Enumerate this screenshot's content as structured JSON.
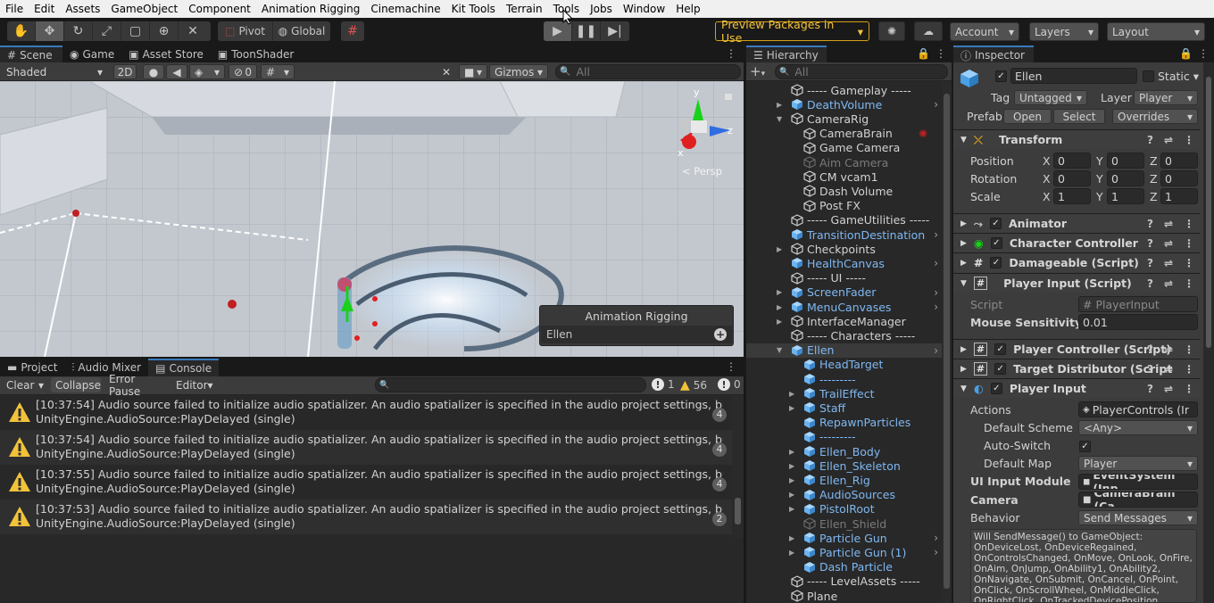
{
  "menu": [
    "File",
    "Edit",
    "Assets",
    "GameObject",
    "Component",
    "Animation Rigging",
    "Cinemachine",
    "Kit Tools",
    "Terrain",
    "Tools",
    "Jobs",
    "Window",
    "Help"
  ],
  "toolbar": {
    "pivot": "Pivot",
    "global": "Global",
    "preview_packages": "Preview Packages in Use",
    "account": "Account",
    "layers": "Layers",
    "layout": "Layout"
  },
  "scene": {
    "tabs": [
      "Scene",
      "Game",
      "Asset Store",
      "ToonShader"
    ],
    "shading": "Shaded",
    "mode_2d": "2D",
    "hidden_count": "0",
    "gizmos": "Gizmos",
    "search_placeholder": "All",
    "persp": "< Persp",
    "gizmo_y": "y",
    "gizmo_z": "z",
    "gizmo_x": "x",
    "overlay_title": "Animation Rigging",
    "overlay_item": "Ellen"
  },
  "console": {
    "tabs": [
      "Project",
      "Audio Mixer",
      "Console"
    ],
    "clear": "Clear",
    "collapse": "Collapse",
    "error_pause": "Error Pause",
    "editor": "Editor",
    "count_errors": "1",
    "count_warnings": "56",
    "count_info": "0",
    "entries": [
      {
        "line1": "[10:37:54] Audio source failed to initialize audio spatializer. An audio spatializer is specified in the audio project settings, but the associated",
        "line2": "UnityEngine.AudioSource:PlayDelayed (single)",
        "count": "4"
      },
      {
        "line1": "[10:37:54] Audio source failed to initialize audio spatializer. An audio spatializer is specified in the audio project settings, but the associated",
        "line2": "UnityEngine.AudioSource:PlayDelayed (single)",
        "count": "4"
      },
      {
        "line1": "[10:37:55] Audio source failed to initialize audio spatializer. An audio spatializer is specified in the audio project settings, but the associated",
        "line2": "UnityEngine.AudioSource:PlayDelayed (single)",
        "count": "4"
      },
      {
        "line1": "[10:37:53] Audio source failed to initialize audio spatializer. An audio spatializer is specified in the audio project settings, but the associated",
        "line2": "UnityEngine.AudioSource:PlayDelayed (single)",
        "count": "2"
      }
    ]
  },
  "hierarchy": {
    "tab": "Hierarchy",
    "add": "+",
    "search_placeholder": "All",
    "items": [
      {
        "label": "----- Gameplay -----",
        "depth": 0,
        "color": "white",
        "fold": ""
      },
      {
        "label": "DeathVolume",
        "depth": 0,
        "color": "blue",
        "fold": "right",
        "arrow": true
      },
      {
        "label": "CameraRig",
        "depth": 0,
        "color": "white",
        "fold": "down"
      },
      {
        "label": "CameraBrain",
        "depth": 1,
        "color": "white",
        "fold": ""
      },
      {
        "label": "Game Camera",
        "depth": 1,
        "color": "white",
        "fold": ""
      },
      {
        "label": "Aim Camera",
        "depth": 1,
        "color": "gray",
        "fold": ""
      },
      {
        "label": "CM vcam1",
        "depth": 1,
        "color": "white",
        "fold": ""
      },
      {
        "label": "Dash Volume",
        "depth": 1,
        "color": "white",
        "fold": ""
      },
      {
        "label": "Post FX",
        "depth": 1,
        "color": "white",
        "fold": ""
      },
      {
        "label": "----- GameUtilities -----",
        "depth": 0,
        "color": "white",
        "fold": ""
      },
      {
        "label": "TransitionDestination",
        "depth": 0,
        "color": "blue",
        "fold": "",
        "arrow": true
      },
      {
        "label": "Checkpoints",
        "depth": 0,
        "color": "white",
        "fold": "right"
      },
      {
        "label": "HealthCanvas",
        "depth": 0,
        "color": "blue",
        "fold": "",
        "arrow": true
      },
      {
        "label": "----- UI -----",
        "depth": 0,
        "color": "white",
        "fold": ""
      },
      {
        "label": "ScreenFader",
        "depth": 0,
        "color": "blue",
        "fold": "right",
        "arrow": true
      },
      {
        "label": "MenuCanvases",
        "depth": 0,
        "color": "blue",
        "fold": "right",
        "arrow": true
      },
      {
        "label": "InterfaceManager",
        "depth": 0,
        "color": "white",
        "fold": "right"
      },
      {
        "label": "----- Characters -----",
        "depth": 0,
        "color": "white",
        "fold": ""
      },
      {
        "label": "Ellen",
        "depth": 0,
        "color": "blue",
        "fold": "down",
        "arrow": true,
        "selected": true
      },
      {
        "label": "HeadTarget",
        "depth": 1,
        "color": "blue",
        "fold": ""
      },
      {
        "label": "---------",
        "depth": 1,
        "color": "blue",
        "fold": ""
      },
      {
        "label": "TrailEffect",
        "depth": 1,
        "color": "blue",
        "fold": "right"
      },
      {
        "label": "Staff",
        "depth": 1,
        "color": "blue",
        "fold": "right"
      },
      {
        "label": "RepawnParticles",
        "depth": 1,
        "color": "blue",
        "fold": ""
      },
      {
        "label": "---------",
        "depth": 1,
        "color": "blue",
        "fold": ""
      },
      {
        "label": "Ellen_Body",
        "depth": 1,
        "color": "blue",
        "fold": "right"
      },
      {
        "label": "Ellen_Skeleton",
        "depth": 1,
        "color": "blue",
        "fold": "right"
      },
      {
        "label": "Ellen_Rig",
        "depth": 1,
        "color": "blue",
        "fold": "right"
      },
      {
        "label": "AudioSources",
        "depth": 1,
        "color": "blue",
        "fold": "right"
      },
      {
        "label": "PistolRoot",
        "depth": 1,
        "color": "blue",
        "fold": "right"
      },
      {
        "label": "Ellen_Shield",
        "depth": 1,
        "color": "gray",
        "fold": ""
      },
      {
        "label": "Particle Gun",
        "depth": 1,
        "color": "blue",
        "fold": "right",
        "arrow": true
      },
      {
        "label": "Particle Gun (1)",
        "depth": 1,
        "color": "blue",
        "fold": "right",
        "arrow": true
      },
      {
        "label": "Dash Particle",
        "depth": 1,
        "color": "blue",
        "fold": ""
      },
      {
        "label": "----- LevelAssets -----",
        "depth": 0,
        "color": "white",
        "fold": ""
      },
      {
        "label": "Plane",
        "depth": 0,
        "color": "white",
        "fold": ""
      }
    ]
  },
  "inspector": {
    "tab": "Inspector",
    "object_name": "Ellen",
    "static": "Static",
    "tag_label": "Tag",
    "tag_value": "Untagged",
    "layer_label": "Layer",
    "layer_value": "Player",
    "prefab_label": "Prefab",
    "open": "Open",
    "select": "Select",
    "overrides": "Overrides",
    "transform": {
      "title": "Transform",
      "position_label": "Position",
      "position": [
        "0",
        "0",
        "0"
      ],
      "rotation_label": "Rotation",
      "rotation": [
        "0",
        "0",
        "0"
      ],
      "scale_label": "Scale",
      "scale": [
        "1",
        "1",
        "1"
      ],
      "x": "X",
      "y": "Y",
      "z": "Z"
    },
    "components": [
      {
        "title": "Animator",
        "checked": true
      },
      {
        "title": "Character Controller",
        "checked": true
      },
      {
        "title": "Damageable (Script)",
        "checked": true
      }
    ],
    "player_input_script": {
      "title": "Player Input (Script)",
      "script_label": "Script",
      "script_value": "PlayerInput",
      "mouse_label": "Mouse Sensitivity",
      "mouse_value": "0.01"
    },
    "player_controller": "Player Controller (Script)",
    "target_distributor": "Target Distributor (Script",
    "player_input": {
      "title": "Player Input",
      "actions_label": "Actions",
      "actions_value": "PlayerControls (Ir",
      "default_scheme_label": "Default Scheme",
      "default_scheme_value": "<Any>",
      "auto_switch_label": "Auto-Switch",
      "default_map_label": "Default Map",
      "default_map_value": "Player",
      "ui_module_label": "UI Input Module",
      "ui_module_value": "EventSystem (Inp",
      "camera_label": "Camera",
      "camera_value": "CameraBrain (Ca",
      "behavior_label": "Behavior",
      "behavior_value": "Send Messages",
      "help": "Will SendMessage() to GameObject: OnDeviceLost, OnDeviceRegained, OnControlsChanged, OnMove, OnLook, OnFire, OnAim, OnJump, OnAbility1, OnAbility2, OnNavigate, OnSubmit, OnCancel, OnPoint, OnClick, OnScrollWheel, OnMiddleClick, OnRightClick, OnTrackedDevicePosition, OnTrackedDeviceOrientation"
    }
  }
}
